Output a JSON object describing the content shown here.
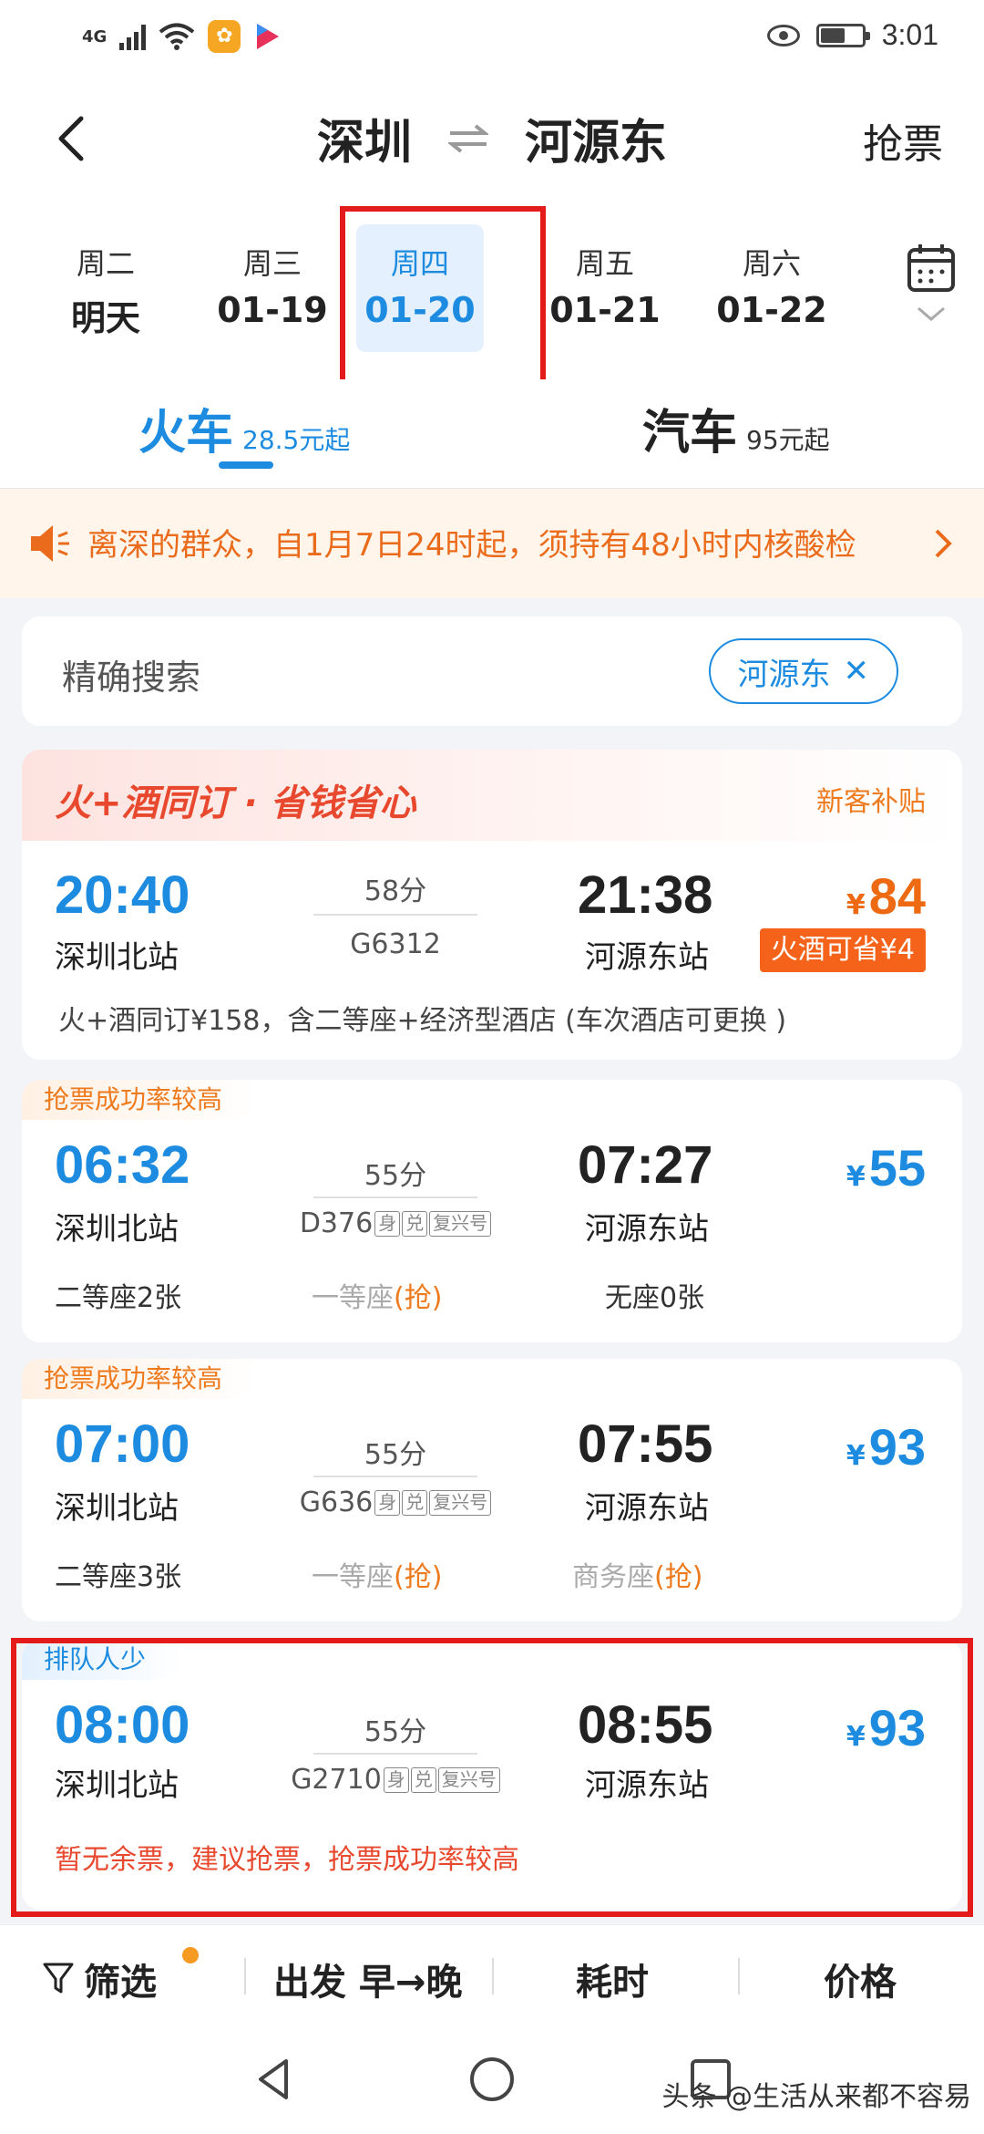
{
  "status_bar": {
    "network": "4G",
    "time": "3:01",
    "app1_glyph": "✿"
  },
  "header": {
    "from": "深圳",
    "to": "河源东",
    "grab": "抢票"
  },
  "dates": [
    {
      "weekday": "周二",
      "date": "明天",
      "selected": false
    },
    {
      "weekday": "周三",
      "date": "01-19",
      "selected": false
    },
    {
      "weekday": "周四",
      "date": "01-20",
      "selected": true
    },
    {
      "weekday": "周五",
      "date": "01-21",
      "selected": false
    },
    {
      "weekday": "周六",
      "date": "01-22",
      "selected": false
    }
  ],
  "tabs": {
    "train": {
      "label": "火车",
      "price": "28.5元起"
    },
    "bus": {
      "label": "汽车",
      "price": "95元起"
    }
  },
  "notice": {
    "text": "离深的群众，自1月7日24时起，须持有48小时内核酸检"
  },
  "search": {
    "label": "精确搜索",
    "chip": "河源东",
    "chip_close": "✕"
  },
  "promo_card": {
    "title": "火+酒同订 · 省钱省心",
    "subtitle": "新客补贴",
    "dep_time": "20:40",
    "dep_station": "深圳北站",
    "duration": "58分",
    "train_no": "G6312",
    "arr_time": "21:38",
    "arr_station": "河源东站",
    "yen": "¥",
    "price": "84",
    "save_badge": "火酒可省¥4",
    "desc": "火+酒同订¥158，含二等座+经济型酒店 (车次酒店可更换 )"
  },
  "trains": [
    {
      "tag": "抢票成功率较高",
      "dep_time": "06:32",
      "dep_station": "深圳北站",
      "duration": "55分",
      "train_no": "D376",
      "icons": [
        "身",
        "兑",
        "复兴号"
      ],
      "arr_time": "07:27",
      "arr_station": "河源东站",
      "yen": "¥",
      "price": "55",
      "seat1": "二等座2张",
      "seat2_name": "一等座",
      "seat2_grab": "(抢)",
      "seat3": "无座0张"
    },
    {
      "tag": "抢票成功率较高",
      "dep_time": "07:00",
      "dep_station": "深圳北站",
      "duration": "55分",
      "train_no": "G636",
      "icons": [
        "身",
        "兑",
        "复兴号"
      ],
      "arr_time": "07:55",
      "arr_station": "河源东站",
      "yen": "¥",
      "price": "93",
      "seat1": "二等座3张",
      "seat2_name": "一等座",
      "seat2_grab": "(抢)",
      "seat3_name": "商务座",
      "seat3_grab": "(抢)"
    },
    {
      "tag": "排队人少",
      "dep_time": "08:00",
      "dep_station": "深圳北站",
      "duration": "55分",
      "train_no": "G2710",
      "icons": [
        "身",
        "兑",
        "复兴号"
      ],
      "arr_time": "08:55",
      "arr_station": "河源东站",
      "yen": "¥",
      "price": "93",
      "warning": "暂无余票，建议抢票，抢票成功率较高"
    }
  ],
  "bottom_bar": {
    "filter": "筛选",
    "depart": "出发 早→晚",
    "duration": "耗时",
    "price": "价格"
  },
  "watermark": "头条 @生活从来都不容易",
  "colors": {
    "accent": "#1d8ce0",
    "orange": "#ee6a12",
    "red": "#e31b1b"
  }
}
